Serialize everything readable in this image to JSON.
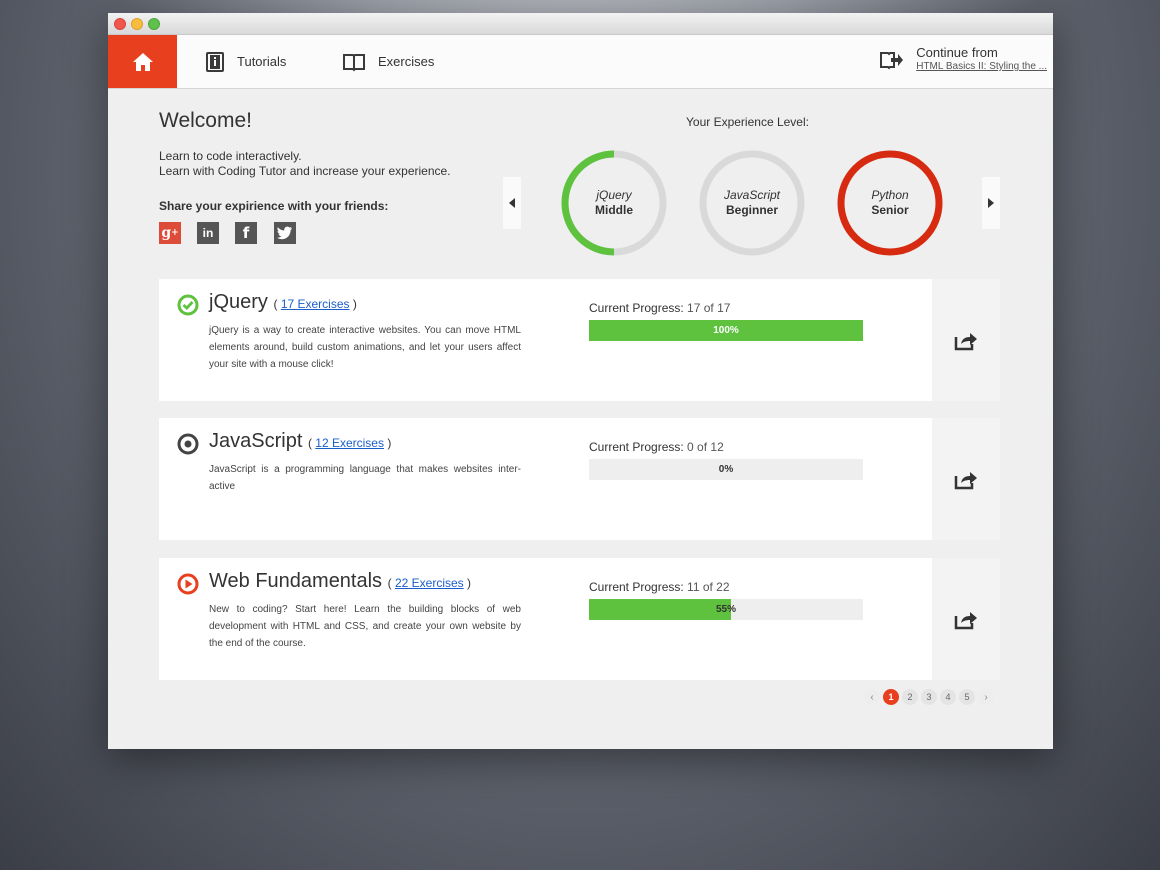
{
  "nav": {
    "tutorials_label": "Tutorials",
    "exercises_label": "Exercises",
    "continue_title": "Continue from",
    "continue_link": "HTML Basics II: Styling the ..."
  },
  "welcome": {
    "title": "Welcome!",
    "line1": "Learn to code interactively.",
    "line2": "Learn with Coding Tutor and increase your experience.",
    "share_label": "Share your expirience with your friends:",
    "social_icons": [
      "google-plus-icon",
      "linkedin-icon",
      "facebook-icon",
      "twitter-icon"
    ]
  },
  "experience": {
    "label": "Your Experience Level:",
    "rings": [
      {
        "lang": "jQuery",
        "level": "Middle",
        "fraction": 0.5,
        "color": "#5ec23f"
      },
      {
        "lang": "JavaScript",
        "level": "Beginner",
        "fraction": 0,
        "color": "#d9d9d9"
      },
      {
        "lang": "Python",
        "level": "Senior",
        "fraction": 1,
        "color": "#d62b10"
      }
    ]
  },
  "courses": [
    {
      "title": "jQuery",
      "exercises": "17 Exercises",
      "description": "jQuery is a way to create interactive websites. You can move HTML elements around, build custom animations, and let your users affect your site with a mouse click!",
      "progress_label": "Current Progress:",
      "progress_value": "17 of 17",
      "percent_label": "100%",
      "fraction": 1.0,
      "status_icon": "check-circle-icon"
    },
    {
      "title": "JavaScript",
      "exercises": "12 Exercises",
      "description": "JavaScript is a programming language that makes websites inter-active",
      "progress_label": "Current Progress:",
      "progress_value": "0 of 12",
      "percent_label": "0%",
      "fraction": 0.0,
      "status_icon": "target-circle-icon"
    },
    {
      "title": "Web Fundamentals",
      "exercises": "22 Exercises",
      "description": "New to coding? Start here! Learn the building blocks of web development with HTML and CSS, and create your own website by the end of the course.",
      "progress_label": "Current Progress:",
      "progress_value": "11 of 22",
      "percent_label": "55%",
      "fraction": 0.52,
      "status_icon": "play-circle-icon"
    }
  ],
  "pagination": {
    "pages": [
      "1",
      "2",
      "3",
      "4",
      "5"
    ],
    "active": "1",
    "prev": "‹",
    "next": "›"
  },
  "colors": {
    "accent": "#e8401f",
    "progress": "#5ec23f",
    "link": "#1a5ec9"
  }
}
